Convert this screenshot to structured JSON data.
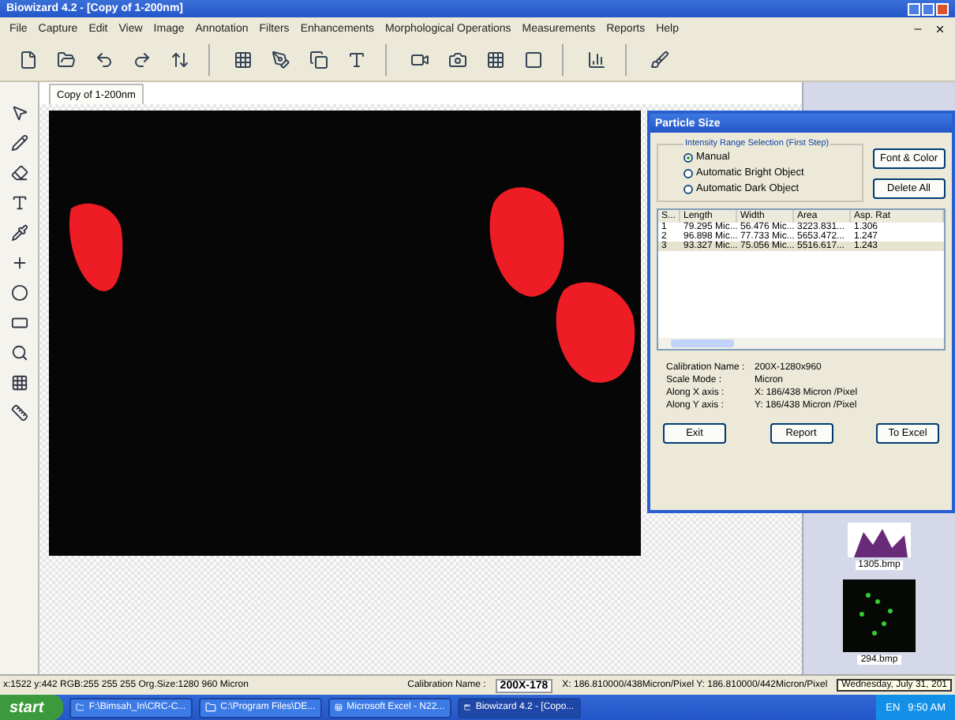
{
  "window": {
    "title": "Biowizard 4.2 - [Copy of 1-200nm]"
  },
  "menu": [
    "File",
    "Capture",
    "Edit",
    "View",
    "Image",
    "Annotation",
    "Filters",
    "Enhancements",
    "Morphological Operations",
    "Measurements",
    "Reports",
    "Help"
  ],
  "document_tab": {
    "label": "Copy of 1-200nm"
  },
  "dialog": {
    "title": "Particle Size",
    "group_label": "Intensity Range Selection (First Step)",
    "options": [
      {
        "label": "Manual",
        "selected": true
      },
      {
        "label": "Automatic Bright Object",
        "selected": false
      },
      {
        "label": "Automatic Dark Object",
        "selected": false
      }
    ],
    "side_buttons": [
      "Font & Color",
      "Delete All"
    ],
    "table": {
      "columns": [
        "S...",
        "Length",
        "Width",
        "Area",
        "Asp. Rat"
      ],
      "rows": [
        {
          "cells": [
            "1",
            "79.295 Mic...",
            "56.476 Mic...",
            "3223.831...",
            "1.306"
          ],
          "selected": false
        },
        {
          "cells": [
            "2",
            "96.898 Mic...",
            "77.733 Mic...",
            "5653.472...",
            "1.247"
          ],
          "selected": false
        },
        {
          "cells": [
            "3",
            "93.327 Mic...",
            "75.056 Mic...",
            "5516.617...",
            "1.243"
          ],
          "selected": true
        }
      ]
    },
    "info": [
      {
        "label": "Calibration Name :",
        "value": "200X-1280x960"
      },
      {
        "label": "Scale Mode :",
        "value": "Micron"
      },
      {
        "label": "Along X axis :",
        "value": "X: 186/438 Micron /Pixel"
      },
      {
        "label": "Along Y axis :",
        "value": "Y: 186/438 Micron /Pixel"
      }
    ],
    "buttons": [
      "Exit",
      "Report",
      "To Excel"
    ]
  },
  "thumbnails": [
    {
      "label": "1305.bmp",
      "kind": "stain"
    },
    {
      "label": "294.bmp",
      "kind": "fluorescence"
    }
  ],
  "status_bar": {
    "position": "x:1522 y:442 RGB:255 255 255 Org.Size:1280 960 Micron",
    "calibration_label": "Calibration Name :",
    "calibration_value": "200X-178",
    "scale": "X: 186.810000/438Micron/Pixel Y: 186.810000/442Micron/Pixel",
    "date": "Wednesday, July 31, 201"
  },
  "taskbar": {
    "start": "start",
    "tasks": [
      {
        "label": "F:\\Bimsah_In\\CRC-C...",
        "selected": false,
        "kind": "folder"
      },
      {
        "label": "C:\\Program Files\\DE...",
        "selected": false,
        "kind": "folder"
      },
      {
        "label": "Microsoft Excel - N22...",
        "selected": false,
        "kind": "excel"
      },
      {
        "label": "Biowizard 4.2 - [Copo...",
        "selected": true,
        "kind": "app"
      }
    ],
    "language": "EN",
    "clock": "9:50 AM"
  }
}
